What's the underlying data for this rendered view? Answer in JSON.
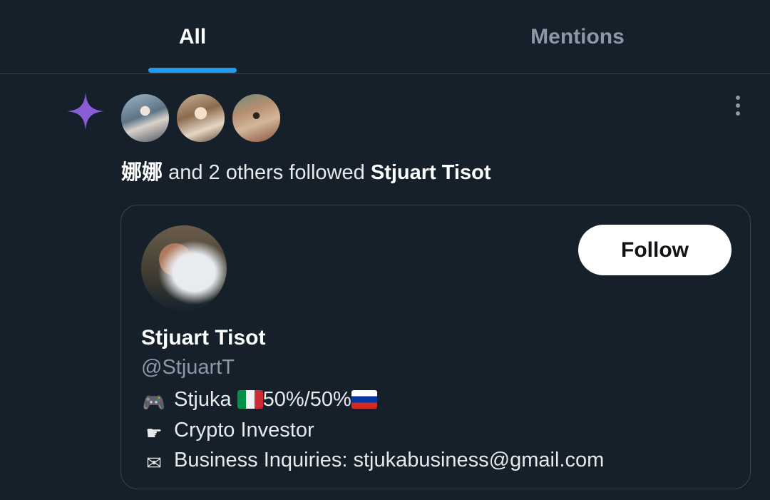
{
  "tabs": {
    "all_label": "All",
    "mentions_label": "Mentions",
    "active": "All",
    "indicator_color": "#1d9bf0"
  },
  "notification": {
    "icon": "sparkle-icon",
    "icon_color": "#8a5cd6",
    "actor_name": "娜娜",
    "connector_text": " and 2 others followed ",
    "target_name": "Stjuart Tisot"
  },
  "user_card": {
    "display_name": "Stjuart Tisot",
    "handle": "@StjuartT",
    "follow_label": "Follow",
    "bio": {
      "line1_icon": "game-controller-icon",
      "line1_prefix": "Stjuka ",
      "line1_flag1": "italy-flag-icon",
      "line1_split": "50%/50%",
      "line1_flag2": "russia-flag-icon",
      "line2_icon": "pointing-hand-icon",
      "line2_text": "Crypto Investor",
      "line3_icon": "envelope-icon",
      "line3_text": "Business Inquiries: stjukabusiness@gmail.com"
    }
  },
  "colors": {
    "background": "#15202b",
    "border": "#38444d",
    "secondary_text": "#8b98a5"
  }
}
